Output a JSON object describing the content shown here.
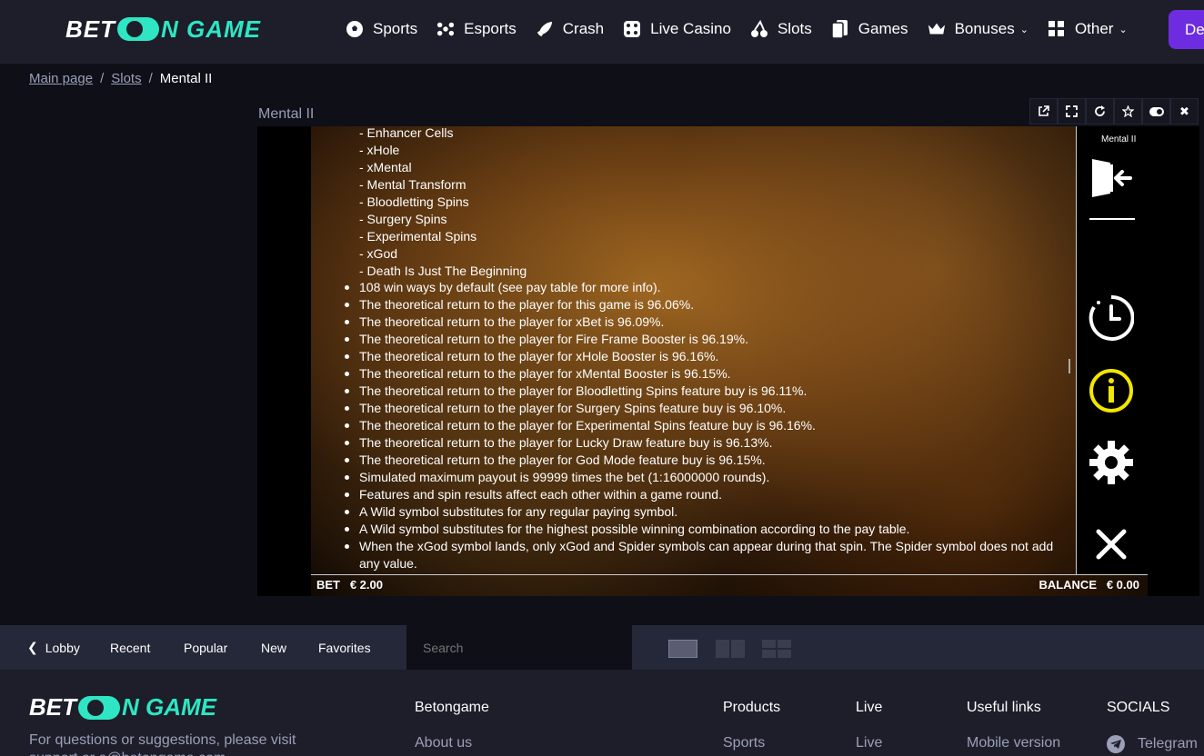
{
  "header": {
    "logo": {
      "left": "BET",
      "right": "N GAME"
    },
    "nav": [
      {
        "label": "Sports",
        "icon": "soccer-ball-icon"
      },
      {
        "label": "Esports",
        "icon": "gamepad-icon"
      },
      {
        "label": "Crash",
        "icon": "rocket-icon"
      },
      {
        "label": "Live Casino",
        "icon": "dice-icon"
      },
      {
        "label": "Slots",
        "icon": "cherry-icon"
      },
      {
        "label": "Games",
        "icon": "cards-icon"
      },
      {
        "label": "Bonuses",
        "icon": "crown-icon",
        "dropdown": true
      },
      {
        "label": "Other",
        "icon": "grid-icon",
        "dropdown": true
      }
    ],
    "deposit_label": "Depo"
  },
  "breadcrumb": {
    "home": "Main page",
    "section": "Slots",
    "current": "Mental II"
  },
  "game": {
    "title": "Mental II",
    "tools": [
      "external-link-icon",
      "fullscreen-icon",
      "refresh-icon",
      "star-icon",
      "toggle-icon",
      "close-icon"
    ],
    "side_title": "Mental II",
    "features": [
      "- Enhancer Cells",
      "- xHole",
      "- xMental",
      "- Mental Transform",
      "- Bloodletting Spins",
      "- Surgery Spins",
      "- Experimental Spins",
      "- xGod",
      "- Death Is Just The Beginning"
    ],
    "rules": [
      "108 win ways by default (see pay table for more info).",
      "The theoretical return to the player for this game is 96.06%.",
      "The theoretical return to the player for xBet is 96.09%.",
      "The theoretical return to the player for Fire Frame Booster is 96.19%.",
      "The theoretical return to the player for xHole Booster is 96.16%.",
      "The theoretical return to the player for xMental Booster is 96.15%.",
      "The theoretical return to the player for Bloodletting Spins feature buy is 96.11%.",
      "The theoretical return to the player for Surgery Spins feature buy is 96.10%.",
      "The theoretical return to the player for Experimental Spins feature buy is 96.16%.",
      "The theoretical return to the player for Lucky Draw feature buy is 96.13%.",
      "The theoretical return to the player for God Mode feature buy is 96.15%.",
      "Simulated maximum payout is 99999 times the bet (1:16000000 rounds).",
      "Features and spin results affect each other within a game round.",
      "A Wild symbol substitutes for any regular paying symbol.",
      "A Wild symbol substitutes for the highest possible winning combination according to the pay table.",
      "When the xGod symbol lands, only xGod and Spider symbols can appear during that spin. The Spider symbol does not add any value."
    ],
    "bet_label": "BET",
    "bet_value": "€ 2.00",
    "balance_label": "BALANCE",
    "balance_value": "€ 0.00",
    "info_icon_color": "#f2e600"
  },
  "bottombar": {
    "lobby": "Lobby",
    "tabs": [
      "Recent",
      "Popular",
      "New",
      "Favorites"
    ],
    "search_placeholder": "Search"
  },
  "footer": {
    "logo": {
      "left": "BET",
      "right": "N GAME"
    },
    "desc": "For questions or suggestions, please visit support or a@betongame.com",
    "columns": [
      {
        "title": "Betongame",
        "link": "About us"
      },
      {
        "title": "Products",
        "link": "Sports"
      },
      {
        "title": "Live",
        "link": "Live"
      },
      {
        "title": "Useful links",
        "link": "Mobile version"
      },
      {
        "title": "SOCIALS",
        "link": "Telegram"
      }
    ]
  },
  "colors": {
    "accent": "#2ee6c3",
    "deposit": "#6d2ce0",
    "bg": "#0e0f17",
    "header": "#1d1e2a"
  }
}
